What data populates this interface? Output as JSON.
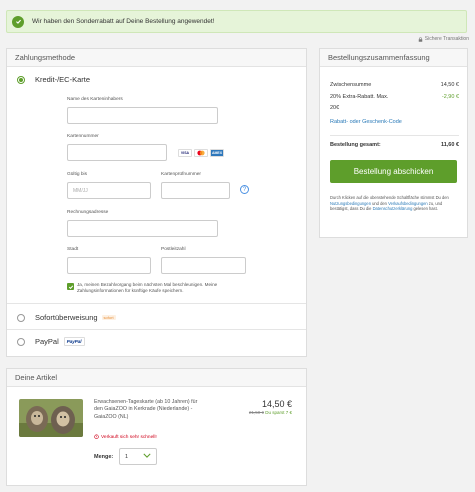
{
  "alert": {
    "text": "Wir haben den Sonderrabatt auf Deine Bestellung angewendet!"
  },
  "secure_label": "Sichere Transaktion",
  "payment": {
    "title": "Zahlungsmethode",
    "selected_method": "Kredit-/EC-Karte",
    "fields": {
      "cardholder_label": "Name des Karteninhabers",
      "cardnumber_label": "Kartennummer",
      "valid_label": "Gültig bis",
      "valid_placeholder": "MM/JJ",
      "cvc_label": "Kartenprüfnummer",
      "address_label": "Rechnungsadresse",
      "city_label": "Stadt",
      "zip_label": "Postleitzahl"
    },
    "card_brands": [
      "VISA",
      "MC",
      "AMEX"
    ],
    "save_checkbox_text": "Ja, meinen Bezahlvorgang beim nächsten Mal beschleunigen. Meine Zahlungsinformationen für künftige Käufe speichern.",
    "other_methods": {
      "sofort": "Sofortüberweisung",
      "sofort_badge": "sofort",
      "paypal": "PayPal",
      "paypal_badge": "PayPal"
    }
  },
  "summary": {
    "title": "Bestellungszusammenfassung",
    "subtotal_label": "Zwischensumme",
    "subtotal_value": "14,50 €",
    "discount_label": "20% Extra-Rabatt. Max.",
    "discount_label_2": "20€",
    "discount_value": "-2,90 €",
    "promo_link": "Rabatt- oder Geschenk-Code",
    "total_label": "Bestellung gesamt:",
    "total_value": "11,60 €",
    "submit_label": "Bestellung abschicken",
    "fine_print": {
      "p1": "Durch Klicken auf die obenstehende Schaltfläche stimmst Du den ",
      "terms_link": "Nutzungsbedingungen",
      "p2": " und den ",
      "sale_link": "Verkaufsbedingungen",
      "p3": " zu, und bestätigst, dass Du die ",
      "privacy_link": "Datenschutzerklärung",
      "p4": " gelesen hast."
    }
  },
  "items": {
    "title": "Deine Artikel",
    "product": {
      "description": "Erwachsenen-Tageskarte (ab 10 Jahren) für den GaiaZOO in Kerkrade (Niederlande) - GaiaZOO (NL)",
      "price": "14,50 €",
      "old_price": "21,50 €",
      "saving": "Du sparst 7 €",
      "selling_fast": "Verkauft sich sehr schnell!",
      "qty_label": "Menge:",
      "qty_value": "1"
    }
  },
  "colors": {
    "accent_green": "#5e9e2b",
    "link_blue": "#2a7ab8",
    "warning_red": "#d0021b"
  }
}
